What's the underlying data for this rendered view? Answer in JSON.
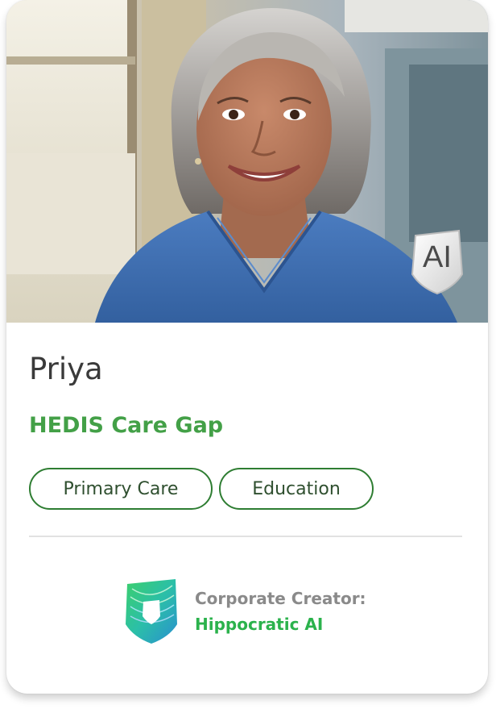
{
  "card": {
    "photo_alt": "Priya",
    "badge": {
      "label": "AI",
      "icon": "shield-icon"
    },
    "name": "Priya",
    "role": "HEDIS Care Gap",
    "tags": [
      "Primary Care",
      "Education"
    ],
    "creator": {
      "label": "Corporate Creator:",
      "name": "Hippocratic AI",
      "icon": "hippocratic-shield-logo-icon"
    }
  },
  "colors": {
    "accent_green": "#43a047",
    "tag_border": "#2e7d32",
    "creator_green": "#2bb24c",
    "scrubs_blue": "#3f6fb2"
  }
}
